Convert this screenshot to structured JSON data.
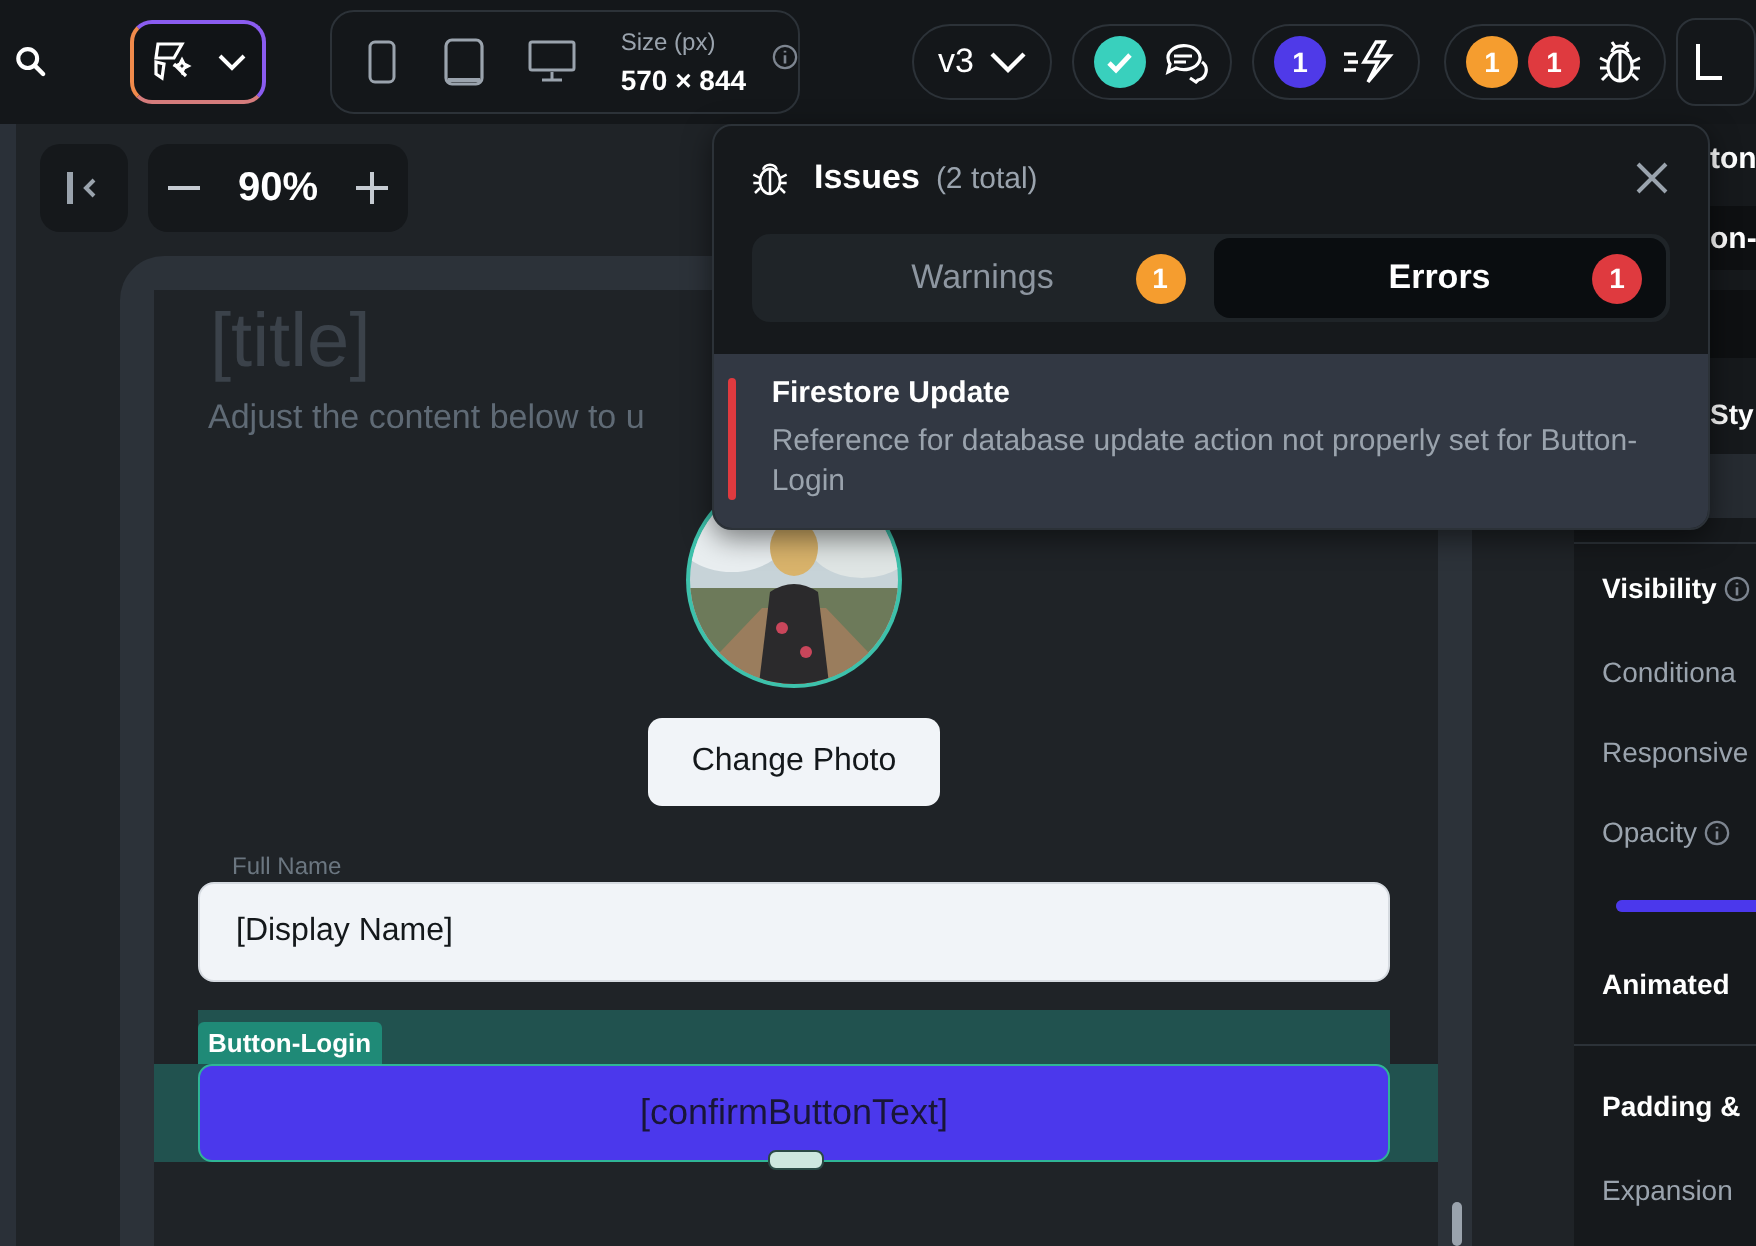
{
  "toolbar": {
    "size_label": "Size (px)",
    "size_value": "570 × 844",
    "version": "v3",
    "actions_count": "1",
    "issue_counts": [
      {
        "text": "1",
        "color": "#f59d2f"
      },
      {
        "text": "1",
        "color": "#df3a3f"
      }
    ]
  },
  "zoom": {
    "value": "90%"
  },
  "canvas": {
    "title": "[title]",
    "subtitle": "Adjust the content below to u",
    "change_photo": "Change Photo",
    "field": {
      "label": "Full Name",
      "value": "[Display Name]"
    },
    "selection_tag": "Button-Login",
    "button": "[confirmButtonText]"
  },
  "issues": {
    "title": "Issues",
    "total": "(2 total)",
    "tabs": [
      {
        "label": "Warnings",
        "count": "1",
        "color": "#f59d2f",
        "selected": false
      },
      {
        "label": "Errors",
        "count": "1",
        "color": "#df3a3f",
        "selected": true
      }
    ],
    "items": [
      {
        "title": "Firestore Update",
        "message": "Reference for database update action not properly set for Button-Login"
      }
    ]
  },
  "panel": {
    "header": "ton",
    "field_value": "on-",
    "style_label": "Sty",
    "rows": [
      {
        "kind": "heading",
        "text": "Visibility",
        "info": true
      },
      {
        "kind": "label",
        "text": "Conditiona",
        "info": false
      },
      {
        "kind": "label",
        "text": "Responsive",
        "info": false
      },
      {
        "kind": "label",
        "text": "Opacity",
        "info": true
      },
      {
        "kind": "slider",
        "level": 1
      },
      {
        "kind": "heading",
        "text": "Animated",
        "info": false
      },
      {
        "kind": "divider"
      },
      {
        "kind": "heading",
        "text": "Padding &",
        "info": false
      },
      {
        "kind": "label",
        "text": "Expansion",
        "info": false
      }
    ]
  }
}
